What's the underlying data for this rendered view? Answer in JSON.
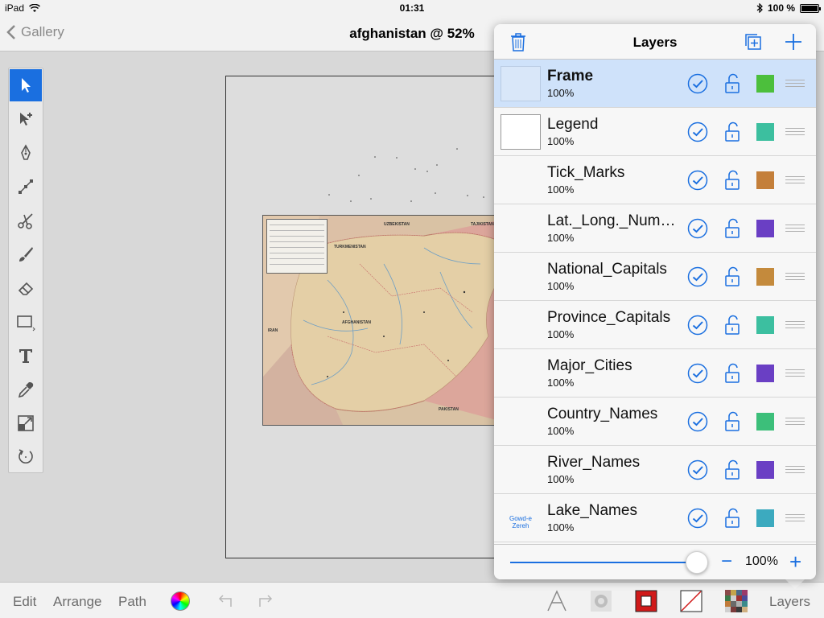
{
  "status_bar": {
    "device": "iPad",
    "time": "01:31",
    "battery": "100 %"
  },
  "nav": {
    "back_label": "Gallery",
    "title": "afghanistan @ 52%"
  },
  "tools": [
    {
      "icon": "select-arrow-icon",
      "active": true
    },
    {
      "icon": "point-select-icon",
      "active": false
    },
    {
      "icon": "pen-nib-icon",
      "active": false
    },
    {
      "icon": "node-path-icon",
      "active": false
    },
    {
      "icon": "scissors-icon",
      "active": false
    },
    {
      "icon": "brush-icon",
      "active": false
    },
    {
      "icon": "eraser-icon",
      "active": false
    },
    {
      "icon": "rectangle-icon",
      "active": false
    },
    {
      "icon": "text-tool-icon",
      "active": false
    },
    {
      "icon": "eyedropper-icon",
      "active": false
    },
    {
      "icon": "scale-icon",
      "active": false
    },
    {
      "icon": "rotate-icon",
      "active": false
    }
  ],
  "map": {
    "labels": [
      "UZBEKISTAN",
      "TAJIKISTAN",
      "TURKMENISTAN",
      "AFGHANISTAN",
      "IRAN",
      "PAKISTAN"
    ]
  },
  "bottom_bar": {
    "edit": "Edit",
    "arrange": "Arrange",
    "path": "Path",
    "layers": "Layers"
  },
  "layers_panel": {
    "title": "Layers",
    "layers": [
      {
        "name": "Frame",
        "opacity": "100%",
        "color": "#4cbf3c",
        "selected": true,
        "thumb_text": ""
      },
      {
        "name": "Legend",
        "opacity": "100%",
        "color": "#3cbf9f",
        "selected": false,
        "thumb_text": ""
      },
      {
        "name": "Tick_Marks",
        "opacity": "100%",
        "color": "#c47f3a",
        "selected": false,
        "thumb_text": ""
      },
      {
        "name": "Lat._Long._Num…",
        "opacity": "100%",
        "color": "#6a3fc4",
        "selected": false,
        "thumb_text": ""
      },
      {
        "name": "National_Capitals",
        "opacity": "100%",
        "color": "#c48a3c",
        "selected": false,
        "thumb_text": ""
      },
      {
        "name": "Province_Capitals",
        "opacity": "100%",
        "color": "#3cbfa0",
        "selected": false,
        "thumb_text": ""
      },
      {
        "name": "Major_Cities",
        "opacity": "100%",
        "color": "#6a3fc4",
        "selected": false,
        "thumb_text": ""
      },
      {
        "name": "Country_Names",
        "opacity": "100%",
        "color": "#3cbf7a",
        "selected": false,
        "thumb_text": ""
      },
      {
        "name": "River_Names",
        "opacity": "100%",
        "color": "#6a3fc4",
        "selected": false,
        "thumb_text": ""
      },
      {
        "name": "Lake_Names",
        "opacity": "100%",
        "color": "#3caabf",
        "selected": false,
        "thumb_text": "Gowd-e Zereh"
      }
    ],
    "opacity_value": "100%",
    "slider_fraction": 1.0
  },
  "colors": {
    "accent": "#1a6fe0",
    "selected_row": "#cfe2fa"
  }
}
